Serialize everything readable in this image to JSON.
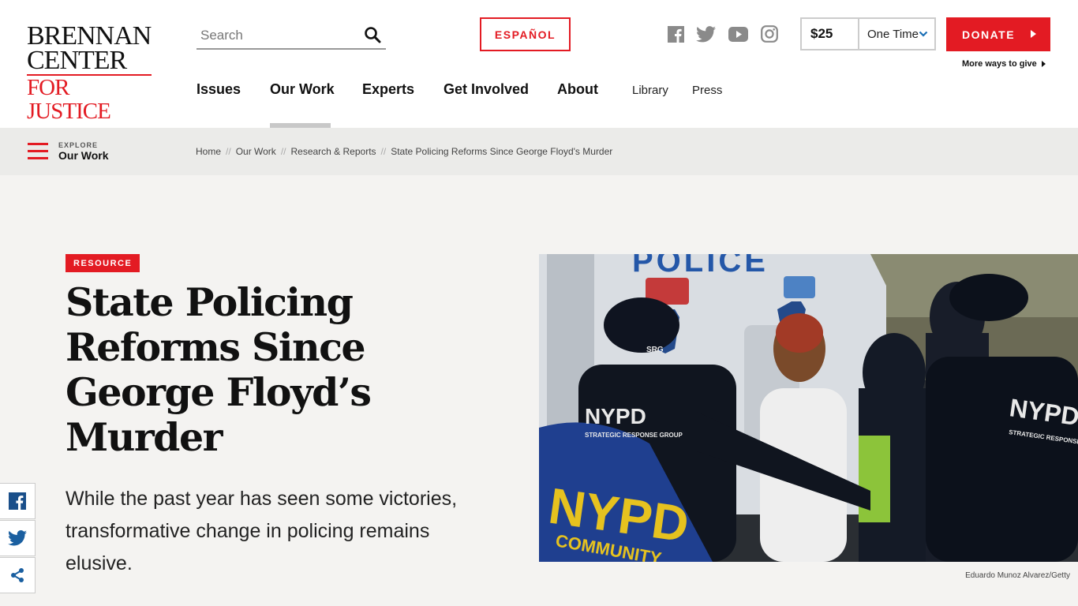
{
  "logo": {
    "line1": "BRENNAN",
    "line2": "CENTER",
    "line3": "FOR JUSTICE"
  },
  "search": {
    "placeholder": "Search",
    "icon": "search-icon"
  },
  "language_button": "ESPAÑOL",
  "social_icons": [
    "facebook-icon",
    "twitter-icon",
    "youtube-icon",
    "instagram-icon"
  ],
  "donation": {
    "amount": "$25",
    "frequency": "One Time",
    "donate_label": "DONATE",
    "more_ways": "More ways to give"
  },
  "nav": {
    "main": [
      "Issues",
      "Our Work",
      "Experts",
      "Get Involved",
      "About"
    ],
    "secondary": [
      "Library",
      "Press"
    ],
    "active": "Our Work"
  },
  "explore": {
    "small": "EXPLORE",
    "big": "Our Work"
  },
  "breadcrumb": [
    "Home",
    "Our Work",
    "Research & Reports",
    "State Policing Reforms Since George Floyd's Murder"
  ],
  "breadcrumb_separator": "//",
  "article": {
    "tag": "RESOURCE",
    "title": "State Policing Reforms Since George Floyd’s Murder",
    "dek": "While the past year has seen some victories, transformative change in policing remains elusive.",
    "photo_credit": "Eduardo Munoz Alvarez/Getty",
    "photo_texts": {
      "van": "POLICE",
      "jacket_left": "NYPD",
      "jacket_left_sub": "STRATEGIC RESPONSE GROUP",
      "jacket_right": "NYPD",
      "jacket_right_sub": "STRATEGIC RESPONSE GROUP",
      "jacket_blue": "NYPD",
      "jacket_blue_sub": "COMMUNITY",
      "cap": "SRG"
    }
  },
  "share_icons": [
    "facebook-share-icon",
    "twitter-share-icon",
    "share-icon"
  ],
  "colors": {
    "brand_red": "#e31b23",
    "hero_bg": "#f4f3f1",
    "crumb_bg": "#ebebe9"
  }
}
